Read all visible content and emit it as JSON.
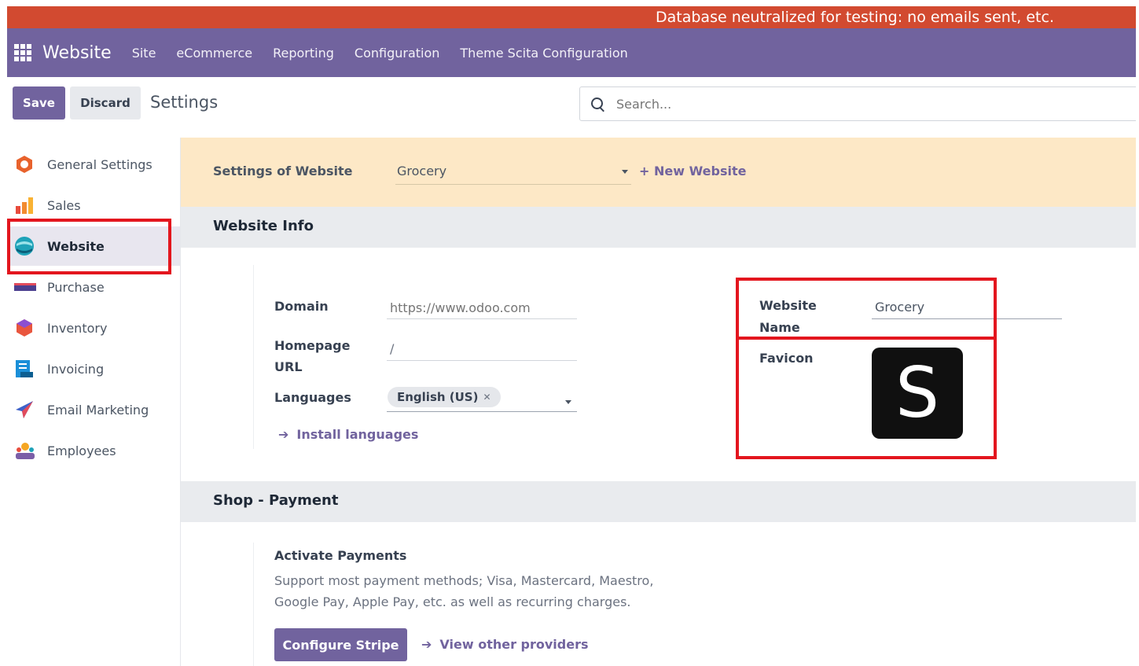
{
  "banner": {
    "text": "Database neutralized for testing: no emails sent, etc."
  },
  "navbar": {
    "app_name": "Website",
    "items": [
      "Site",
      "eCommerce",
      "Reporting",
      "Configuration",
      "Theme Scita Configuration"
    ]
  },
  "controlbar": {
    "save_label": "Save",
    "discard_label": "Discard",
    "title": "Settings",
    "search_placeholder": "Search..."
  },
  "sidebar": {
    "items": [
      {
        "label": "General Settings",
        "icon": "general-settings-icon",
        "active": false
      },
      {
        "label": "Sales",
        "icon": "sales-icon",
        "active": false
      },
      {
        "label": "Website",
        "icon": "website-icon",
        "active": true
      },
      {
        "label": "Purchase",
        "icon": "purchase-icon",
        "active": false
      },
      {
        "label": "Inventory",
        "icon": "inventory-icon",
        "active": false
      },
      {
        "label": "Invoicing",
        "icon": "invoicing-icon",
        "active": false
      },
      {
        "label": "Email Marketing",
        "icon": "email-marketing-icon",
        "active": false
      },
      {
        "label": "Employees",
        "icon": "employees-icon",
        "active": false
      }
    ]
  },
  "website_bar": {
    "label": "Settings of Website",
    "selected": "Grocery",
    "new_label": "+ New Website"
  },
  "website_info": {
    "title": "Website Info",
    "domain_label": "Domain",
    "domain_placeholder": "https://www.odoo.com",
    "homepage_label_1": "Homepage",
    "homepage_label_2": "URL",
    "homepage_value": "/",
    "languages_label": "Languages",
    "language_tag": "English (US)",
    "install_languages": "Install languages",
    "website_name_label_1": "Website",
    "website_name_label_2": "Name",
    "website_name_value": "Grocery",
    "favicon_label": "Favicon",
    "favicon_letter": "S"
  },
  "shop_payment": {
    "title": "Shop - Payment",
    "activate_title": "Activate Payments",
    "desc_line1": "Support most payment methods; Visa, Mastercard, Maestro,",
    "desc_line2": "Google Pay, Apple Pay, etc. as well as recurring charges.",
    "configure_label": "Configure Stripe",
    "other_providers": "View other providers"
  },
  "colors": {
    "brand": "#71639e",
    "banner": "#d24a30",
    "highlight_box": "#e3161e",
    "website_bar": "#fde8c6"
  }
}
